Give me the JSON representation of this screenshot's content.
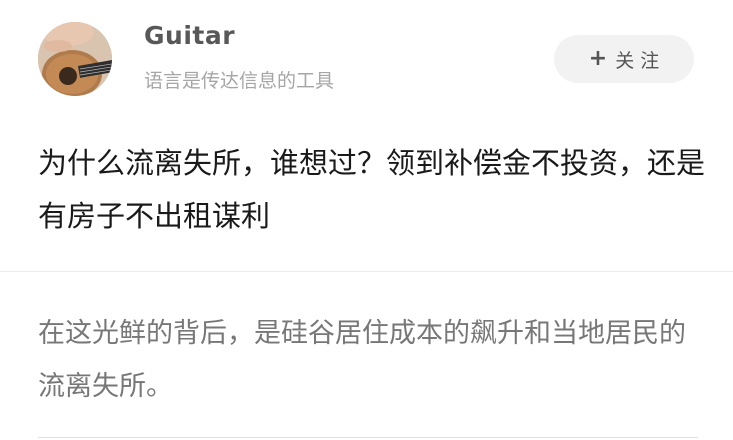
{
  "author": {
    "name": "Guitar",
    "bio": "语言是传达信息的工具",
    "avatar_icon": "guitar-photo"
  },
  "follow_button": {
    "icon": "plus-icon",
    "plus": "+",
    "label": "关 注"
  },
  "post": {
    "title": "为什么流离失所，谁想过？领到补偿金不投资，还是有房子不出租谋利",
    "excerpt": "在这光鲜的背后，是硅谷居住成本的飙升和当地居民的流离失所。"
  }
}
